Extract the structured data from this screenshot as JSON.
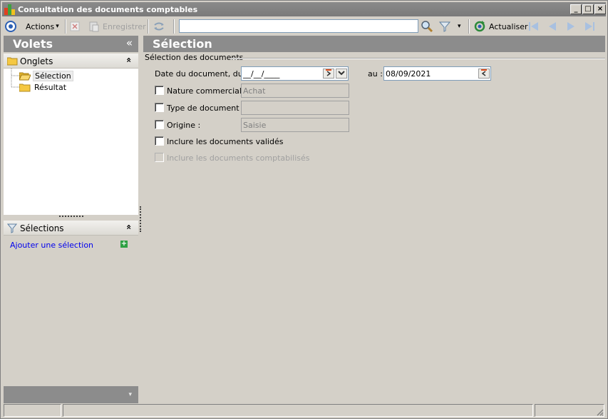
{
  "window": {
    "title": "Consultation des documents comptables",
    "minimize": "_",
    "maximize": "□",
    "close": "×"
  },
  "toolbar": {
    "actions_label": "Actions",
    "save_label": "Enregistrer",
    "refresh_label": "Actualiser",
    "search_value": "",
    "dropdown_glyph": "▾"
  },
  "left_pane": {
    "title": "Volets",
    "collapse_glyph": "«",
    "tabs_section": {
      "label": "Onglets",
      "chevron": "«"
    },
    "tree": [
      {
        "label": "Sélection",
        "selected": true
      },
      {
        "label": "Résultat",
        "selected": false
      }
    ],
    "selections_section": {
      "label": "Sélections",
      "chevron": "«"
    },
    "add_selection_link": "Ajouter une sélection",
    "add_glyph": "+",
    "bottom_chevron": "▾"
  },
  "right_pane": {
    "title": "Sélection",
    "group_title": "Sélection des documents",
    "date_label": "Date du document, du :",
    "date_from_value": "__/__/____",
    "date_to_label": "au :",
    "date_to_value": "08/09/2021",
    "nature_label": "Nature commerciale :",
    "nature_value": "Achat",
    "type_label": "Type de document :",
    "type_value": "",
    "origin_label": "Origine :",
    "origin_value": "Saisie",
    "include_validated_label": "Inclure les documents validés",
    "include_posted_label": "Inclure les documents comptabilisés"
  },
  "colors": {
    "header_bg": "#8c8c8c",
    "window_bg": "#d4d0c8",
    "link": "#0000ee"
  }
}
